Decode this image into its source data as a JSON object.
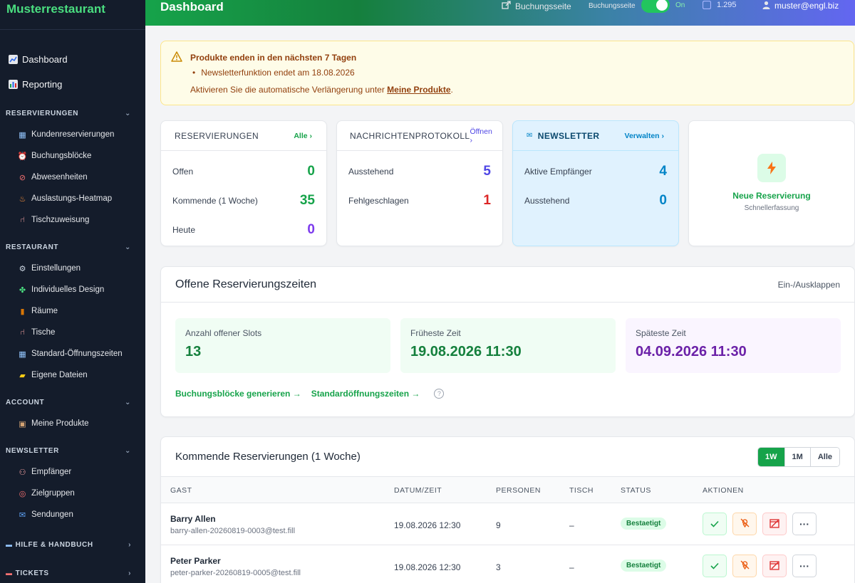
{
  "brand": "Musterrestaurant",
  "header": {
    "title": "Dashboard",
    "booking_link": "Buchungsseite",
    "booking_toggle_label": "Buchungsseite",
    "toggle_state": "on",
    "on_label": "On",
    "count": "1.295",
    "user": "muster@engl.biz"
  },
  "sidebar": {
    "top": [
      {
        "label": "Dashboard",
        "icon": "chart-icon"
      },
      {
        "label": "Reporting",
        "icon": "bar-chart-icon"
      }
    ],
    "sections": [
      {
        "title": "RESERVIERUNGEN",
        "chevron": "⌄",
        "items": [
          {
            "label": "Kundenreservierungen",
            "icon": "calendar-icon"
          },
          {
            "label": "Buchungsblöcke",
            "icon": "alarm-clock-icon"
          },
          {
            "label": "Abwesenheiten",
            "icon": "prohibited-icon"
          },
          {
            "label": "Auslastungs-Heatmap",
            "icon": "fire-icon"
          },
          {
            "label": "Tischzuweisung",
            "icon": "chair-icon"
          }
        ]
      },
      {
        "title": "RESTAURANT",
        "chevron": "⌄",
        "items": [
          {
            "label": "Einstellungen",
            "icon": "gear-icon"
          },
          {
            "label": "Individuelles Design",
            "icon": "puzzle-icon"
          },
          {
            "label": "Räume",
            "icon": "door-icon"
          },
          {
            "label": "Tische",
            "icon": "table-icon"
          },
          {
            "label": "Standard-Öffnungszeiten",
            "icon": "calendar-icon"
          },
          {
            "label": "Eigene Dateien",
            "icon": "folder-icon"
          }
        ]
      },
      {
        "title": "ACCOUNT",
        "chevron": "⌄",
        "items": [
          {
            "label": "Meine Produkte",
            "icon": "package-icon"
          }
        ]
      },
      {
        "title": "NEWSLETTER",
        "chevron": "⌄",
        "items": [
          {
            "label": "Empfänger",
            "icon": "people-icon"
          },
          {
            "label": "Zielgruppen",
            "icon": "target-icon"
          },
          {
            "label": "Sendungen",
            "icon": "mailbox-icon"
          }
        ]
      }
    ],
    "help": {
      "title": "HILFE & HANDBUCH",
      "icon": "book-icon",
      "chevron": "›"
    },
    "tickets": {
      "title": "TICKETS",
      "icon": "ticket-icon",
      "chevron": "›"
    }
  },
  "alert": {
    "title": "Produkte enden in den nächsten 7 Tagen",
    "item": "Newsletterfunktion endet am 18.08.2026",
    "text_before": "Aktivieren Sie die automatische Verlängerung unter ",
    "link": "Meine Produkte",
    "text_after": "."
  },
  "stats": {
    "reservierungen": {
      "title": "RESERVIERUNGEN",
      "link": "Alle",
      "rows": [
        {
          "label": "Offen",
          "value": "0",
          "color": "#16a34a"
        },
        {
          "label": "Kommende (1 Woche)",
          "value": "35",
          "color": "#16a34a"
        },
        {
          "label": "Heute",
          "value": "0",
          "color": "#7c3aed"
        }
      ]
    },
    "nachrichten": {
      "title": "NACHRICHTENPROTOKOLL",
      "link": "Öffnen",
      "rows": [
        {
          "label": "Ausstehend",
          "value": "5",
          "color": "#4f46e5"
        },
        {
          "label": "Fehlgeschlagen",
          "value": "1",
          "color": "#dc2626"
        }
      ]
    },
    "newsletter": {
      "title": "NEWSLETTER",
      "link": "Verwalten",
      "rows": [
        {
          "label": "Aktive Empfänger",
          "value": "4",
          "color": "#0284c7"
        },
        {
          "label": "Ausstehend",
          "value": "0",
          "color": "#0284c7"
        }
      ]
    },
    "quick": {
      "title": "Neue Reservierung",
      "subtitle": "Schnellerfassung"
    }
  },
  "slots": {
    "title": "Offene Reservierungszeiten",
    "toggle": "Ein-/Ausklappen",
    "boxes": [
      {
        "label": "Anzahl offener Slots",
        "value": "13"
      },
      {
        "label": "Früheste Zeit",
        "value": "19.08.2026 11:30"
      },
      {
        "label": "Späteste Zeit",
        "value": "04.09.2026 11:30"
      }
    ],
    "link_generate": "Buchungsblöcke generieren →",
    "link_hours": "Standardöffnungszeiten →",
    "help": "?"
  },
  "reservations": {
    "title": "Kommende Reservierungen (1 Woche)",
    "filters": [
      "1W",
      "1M",
      "Alle"
    ],
    "active_filter": "1W",
    "columns": [
      "GAST",
      "DATUM/ZEIT",
      "PERSONEN",
      "TISCH",
      "STATUS",
      "AKTIONEN"
    ],
    "rows": [
      {
        "name": "Barry Allen",
        "email": "barry-allen-20260819-0003@test.fill",
        "datetime": "19.08.2026 12:30",
        "persons": "9",
        "table": "–",
        "status": "Bestaetigt"
      },
      {
        "name": "Peter Parker",
        "email": "peter-parker-20260819-0005@test.fill",
        "datetime": "19.08.2026 12:30",
        "persons": "3",
        "table": "–",
        "status": "Bestaetigt"
      }
    ],
    "action_icons": [
      "check-icon",
      "no-show-icon",
      "cancel-calendar-icon",
      "more-icon"
    ],
    "more_label": "···"
  }
}
